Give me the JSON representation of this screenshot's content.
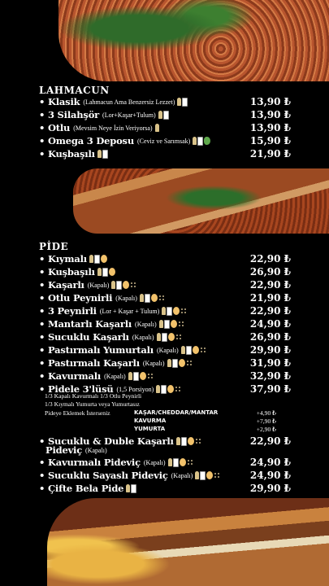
{
  "lahmacun": {
    "title": "LAHMACUN",
    "items": [
      {
        "name": "Klasik",
        "note": "(Lahmacun Ama Benzersiz Lezzet)",
        "price": "13,90 ₺",
        "icons": [
          "wheat-icon",
          "milk-icon"
        ]
      },
      {
        "name": "3 Silahşör",
        "note": "(Lor+Kaşar+Tulum)",
        "price": "13,90 ₺",
        "icons": [
          "wheat-icon",
          "milk-icon"
        ]
      },
      {
        "name": "Otlu",
        "note": "(Mevsim Neye İzin Veriyorsa)",
        "price": "13,90 ₺",
        "icons": [
          "wheat-icon"
        ]
      },
      {
        "name": "Omega 3 Deposu",
        "note": "(Ceviz ve Sarımsak)",
        "price": "15,90 ₺",
        "icons": [
          "wheat-icon",
          "milk-icon",
          "nut-icon"
        ]
      },
      {
        "name": "Kuşbaşılı",
        "note": "",
        "price": "21,90 ₺",
        "icons": [
          "wheat-icon",
          "milk-icon"
        ]
      }
    ]
  },
  "pide": {
    "title": "PİDE",
    "items": [
      {
        "name": "Kıymalı",
        "note": "",
        "price": "22,90 ₺",
        "icons": [
          "wheat-icon",
          "milk-icon",
          "egg-icon"
        ]
      },
      {
        "name": "Kuşbaşılı",
        "note": "",
        "price": "26,90 ₺",
        "icons": [
          "wheat-icon",
          "milk-icon",
          "egg-icon"
        ]
      },
      {
        "name": "Kaşarlı",
        "note": "(Kapalı)",
        "price": "22,90 ₺",
        "icons": [
          "wheat-icon",
          "milk-icon",
          "egg-icon",
          "sesame-icon"
        ]
      },
      {
        "name": "Otlu Peynirli",
        "note": "(Kapalı)",
        "price": "21,90 ₺",
        "icons": [
          "wheat-icon",
          "milk-icon",
          "egg-icon",
          "sesame-icon"
        ]
      },
      {
        "name": "3 Peynirli",
        "note": "(Lor + Kaşar + Tulum)",
        "price": "22,90 ₺",
        "icons": [
          "wheat-icon",
          "milk-icon",
          "egg-icon",
          "sesame-icon"
        ]
      },
      {
        "name": "Mantarlı Kaşarlı",
        "note": "(Kapalı)",
        "price": "24,90 ₺",
        "icons": [
          "wheat-icon",
          "milk-icon",
          "egg-icon",
          "sesame-icon"
        ]
      },
      {
        "name": "Sucuklu Kaşarlı",
        "note": "(Kapalı)",
        "price": "26,90 ₺",
        "icons": [
          "wheat-icon",
          "milk-icon",
          "egg-icon",
          "sesame-icon"
        ]
      },
      {
        "name": "Pastırmalı Yumurtalı",
        "note": "(Kapalı)",
        "price": "29,90 ₺",
        "icons": [
          "wheat-icon",
          "milk-icon",
          "egg-icon",
          "sesame-icon"
        ]
      },
      {
        "name": "Pastırmalı Kaşarlı",
        "note": "(Kapalı)",
        "price": "31,90 ₺",
        "icons": [
          "wheat-icon",
          "milk-icon",
          "egg-icon",
          "sesame-icon"
        ]
      },
      {
        "name": "Kavurmalı",
        "note": "(Kapalı)",
        "price": "32,90 ₺",
        "icons": [
          "wheat-icon",
          "milk-icon",
          "egg-icon",
          "sesame-icon"
        ]
      },
      {
        "name": "Pidele 3'lüsü",
        "note": "(1,5 Porsiyon)",
        "price": "37,90 ₺",
        "icons": [
          "wheat-icon",
          "milk-icon",
          "egg-icon",
          "sesame-icon"
        ]
      }
    ],
    "pidele_desc": [
      "1/3 Kapalı Kavurmalı 1/3 Otlu Peynirli",
      "1/3 Kıymalı Yumurta veya Yumurtasız"
    ],
    "extras": {
      "label": "Pideye Eklemek İsterseniz",
      "options": [
        {
          "name": "KAŞAR/CHEDDAR/MANTAR",
          "price": "+4,90 ₺"
        },
        {
          "name": "KAVURMA",
          "price": "+7,90 ₺"
        },
        {
          "name": "YUMURTA",
          "price": "+2,90 ₺"
        }
      ]
    },
    "items2": [
      {
        "name": "Sucuklu & Duble Kaşarlı",
        "note": "",
        "price": "22,90 ₺",
        "icons": [
          "wheat-icon",
          "milk-icon",
          "egg-icon",
          "sesame-icon"
        ]
      },
      {
        "name": "Kavurmalı Pideviç",
        "note": "(Kapalı)",
        "price": "24,90 ₺",
        "icons": [
          "wheat-icon",
          "milk-icon",
          "egg-icon",
          "sesame-icon"
        ]
      },
      {
        "name": "Sucuklu Sayaslı Pideviç",
        "note": "(Kapalı)",
        "price": "24,90 ₺",
        "icons": [
          "wheat-icon",
          "milk-icon",
          "egg-icon",
          "sesame-icon"
        ]
      },
      {
        "name": "Çifte Bela Pide",
        "note": "",
        "price": "29,90 ₺",
        "icons": [
          "wheat-icon",
          "milk-icon"
        ]
      }
    ],
    "pideviç_label": "Pideviç",
    "pideviç_note": "(Kapalı)"
  }
}
